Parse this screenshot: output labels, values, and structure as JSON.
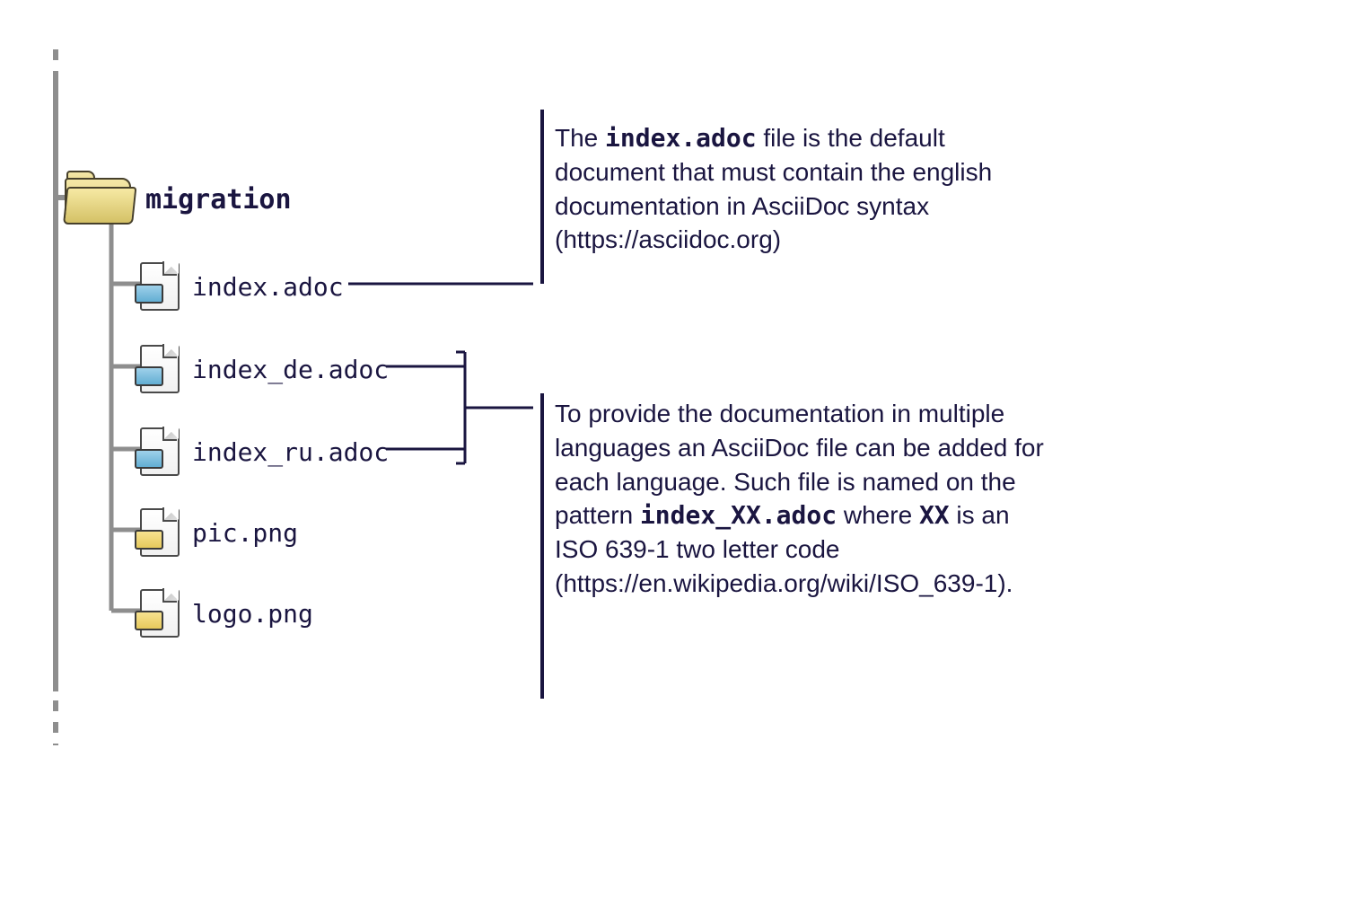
{
  "tree": {
    "folder": "migration",
    "files": {
      "f0": "index.adoc",
      "f1": "index_de.adoc",
      "f2": "index_ru.adoc",
      "f3": "pic.png",
      "f4": "logo.png"
    }
  },
  "annotations": {
    "a1": {
      "pre": "The ",
      "code1": "index.adoc",
      "post": " file is the default document that must contain the english documentation in AsciiDoc syntax (https://asciidoc.org)"
    },
    "a2": {
      "pre": "To provide the documentation in multiple languages an AsciiDoc file can be added for each language. Such file is named on the pattern ",
      "code1": "index_XX.adoc",
      "mid": " where ",
      "code2": "XX",
      "post": " is an ISO 639-1 two letter code (https://en.wikipedia.org/wiki/ISO_639-1)."
    }
  },
  "colors": {
    "ink": "#1a1540",
    "trunk": "#8e8e8e"
  }
}
